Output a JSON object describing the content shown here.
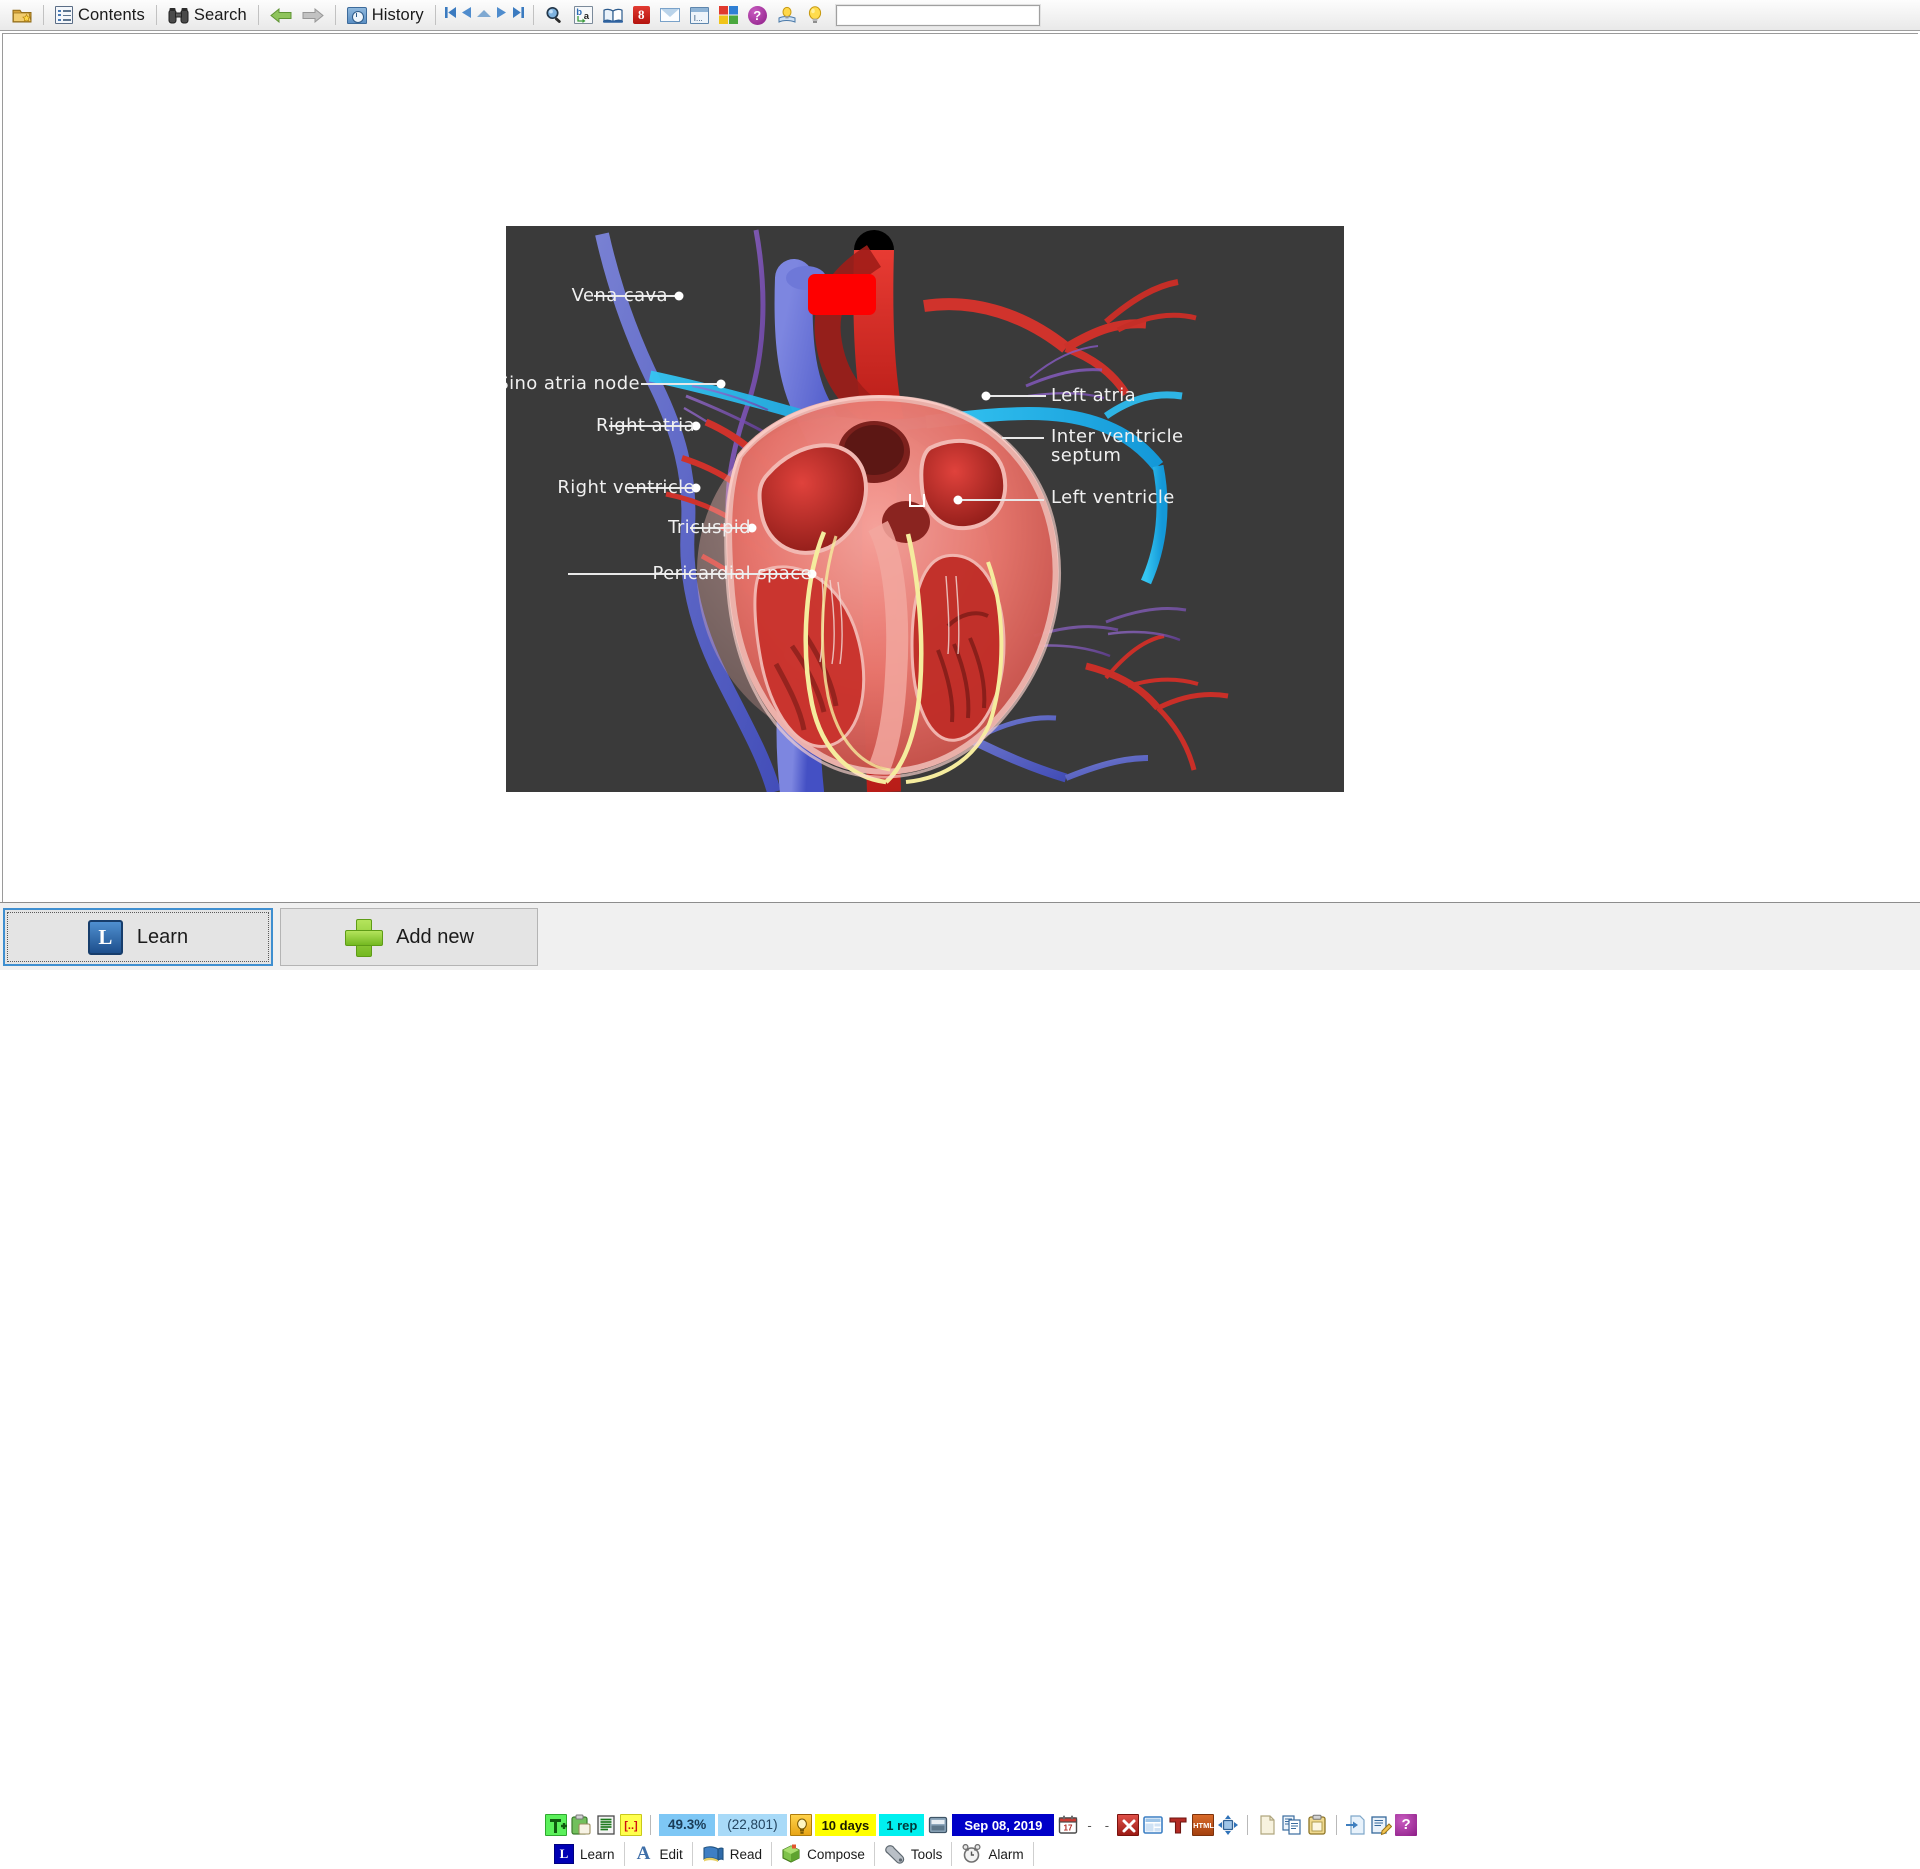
{
  "toolbar": {
    "items": [
      {
        "id": "open-favorites",
        "icon": "open-folder-star-icon",
        "label": ""
      },
      {
        "id": "contents",
        "icon": "contents-icon",
        "label": "Contents"
      },
      {
        "id": "search",
        "icon": "binoculars-icon",
        "label": "Search"
      },
      {
        "id": "back",
        "icon": "arrow-left-icon",
        "label": ""
      },
      {
        "id": "forward",
        "icon": "arrow-right-icon",
        "label": ""
      },
      {
        "id": "history",
        "icon": "history-clock-icon",
        "label": "History"
      }
    ],
    "nav": [
      {
        "id": "first",
        "icon": "skip-first-icon"
      },
      {
        "id": "previous",
        "icon": "triangle-left-icon"
      },
      {
        "id": "up",
        "icon": "triangle-up-icon"
      },
      {
        "id": "next",
        "icon": "triangle-right-icon"
      },
      {
        "id": "last",
        "icon": "skip-last-icon"
      }
    ],
    "tools": [
      {
        "id": "find",
        "icon": "magnifier-icon"
      },
      {
        "id": "translate",
        "icon": "translate-ba-icon"
      },
      {
        "id": "dictionary",
        "icon": "open-book-icon"
      },
      {
        "id": "google-search",
        "icon": "google-g-icon"
      },
      {
        "id": "email",
        "icon": "envelope-icon"
      },
      {
        "id": "text-window",
        "icon": "text-component-icon"
      },
      {
        "id": "windows",
        "icon": "four-color-squares-icon"
      },
      {
        "id": "help",
        "icon": "question-mark-icon"
      },
      {
        "id": "hint-doc",
        "icon": "bulb-over-book-icon"
      },
      {
        "id": "tip",
        "icon": "light-bulb-icon"
      }
    ],
    "search_field": {
      "value": "",
      "placeholder": ""
    }
  },
  "figure": {
    "alt": "Cross-section diagram of the human heart",
    "background_color": "#3a3a3a",
    "occlusion": {
      "color": "#fe0000",
      "shape": "rounded-rectangle"
    },
    "labels": [
      {
        "text": "Vena cava",
        "side": "left"
      },
      {
        "text": "Sino atria node",
        "side": "left"
      },
      {
        "text": "Right atria",
        "side": "left"
      },
      {
        "text": "Right ventricle",
        "side": "left"
      },
      {
        "text": "Tricuspid",
        "side": "left"
      },
      {
        "text": "Pericardial space",
        "side": "left"
      },
      {
        "text": "Left atria",
        "side": "right"
      },
      {
        "text": "Inter ventricle",
        "side": "right"
      },
      {
        "text": "septum",
        "side": "right"
      },
      {
        "text": "Left ventricle",
        "side": "right"
      }
    ]
  },
  "bottom": {
    "learn_button": {
      "label": "Learn",
      "icon": "learn-square-icon"
    },
    "addnew_button": {
      "label": "Add new",
      "icon": "green-plus-icon"
    }
  },
  "status": {
    "left_icons": [
      {
        "id": "add-text",
        "icon": "add-text-icon"
      },
      {
        "id": "paste-article",
        "icon": "clipboard-paste-icon"
      },
      {
        "id": "text-lines",
        "icon": "text-lines-icon"
      },
      {
        "id": "cloze",
        "icon": "cloze-brackets-icon"
      }
    ],
    "percent": "49.3%",
    "count": "(22,801)",
    "priority_icon": "priority-bulb-icon",
    "interval": "10 days",
    "repetitions": "1 rep",
    "calendar_icon": "schedule-icon",
    "date": "Sep 08, 2019",
    "date_picker_icon": "calendar-17-icon",
    "dash1": "-",
    "dash2": "-",
    "right_icons": [
      {
        "id": "delete",
        "icon": "red-x-icon"
      },
      {
        "id": "layout",
        "icon": "window-layout-icon"
      },
      {
        "id": "text-format",
        "icon": "big-t-icon"
      },
      {
        "id": "html-source",
        "icon": "html-icon"
      },
      {
        "id": "fullscreen",
        "icon": "expand-arrows-icon"
      },
      {
        "id": "new-file",
        "icon": "blank-page-icon"
      },
      {
        "id": "copy",
        "icon": "copy-pages-icon"
      },
      {
        "id": "paste",
        "icon": "clipboard-icon"
      },
      {
        "id": "import",
        "icon": "import-page-icon"
      },
      {
        "id": "edit-note",
        "icon": "edit-note-icon"
      },
      {
        "id": "help",
        "icon": "help-circle-icon"
      }
    ]
  },
  "tabs": [
    {
      "id": "learn",
      "label": "Learn",
      "icon": "learn-l-icon",
      "active": true
    },
    {
      "id": "edit",
      "label": "Edit",
      "icon": "letter-a-icon",
      "active": false
    },
    {
      "id": "read",
      "label": "Read",
      "icon": "blue-book-icon",
      "active": false
    },
    {
      "id": "compose",
      "label": "Compose",
      "icon": "green-cube-icon",
      "active": false
    },
    {
      "id": "tools",
      "label": "Tools",
      "icon": "wrench-icon",
      "active": false
    },
    {
      "id": "alarm",
      "label": "Alarm",
      "icon": "alarm-clock-icon",
      "active": false
    }
  ],
  "colors": {
    "accent_blue": "#0000c8",
    "highlight_yellow": "#ffff00",
    "highlight_cyan": "#00f0ef",
    "progress_blue": "#7ec7f5",
    "occlusion_red": "#fe0000",
    "figure_bg": "#3a3a3a"
  }
}
